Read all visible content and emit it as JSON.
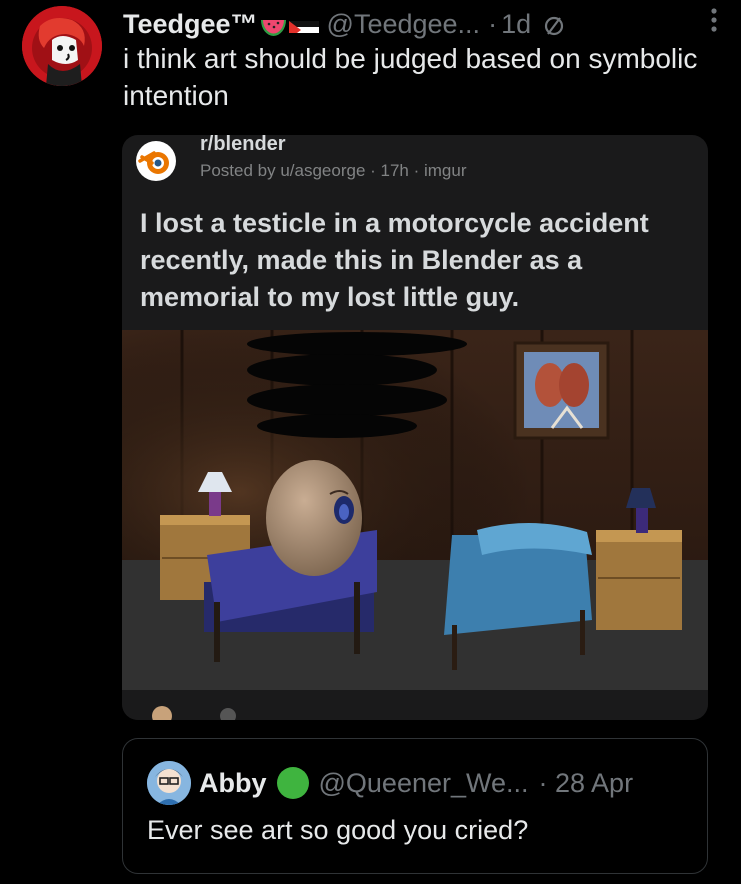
{
  "tweet": {
    "display_name": "Teedgee™",
    "handle": "@Teedgee...",
    "separator": "·",
    "time": "1d",
    "text": "i think art should be judged based on symbolic intention",
    "more_icon": "more-vertical-icon",
    "badges": [
      "watermelon-emoji",
      "palestine-flag-emoji"
    ],
    "status_icon": "no-entry-icon"
  },
  "embedded_post": {
    "subreddit": "r/blender",
    "meta": "Posted by u/asgeorge · 17h · imgur",
    "title": "I lost a testicle in a motorcycle accident recently, made this in Blender as a memorial to my lost little guy.",
    "logo_icon": "blender-logo-icon"
  },
  "quote": {
    "display_name": "Abby",
    "handle": "@Queener_We...",
    "time": "· 28 Apr",
    "text": "Ever see art so good you cried?"
  },
  "colors": {
    "background": "#000000",
    "text_primary": "#e7e9ea",
    "text_secondary": "#71767b",
    "border": "#2f3336",
    "reddit_card": "#1a1a1b",
    "green_badge": "#3fb43f"
  }
}
